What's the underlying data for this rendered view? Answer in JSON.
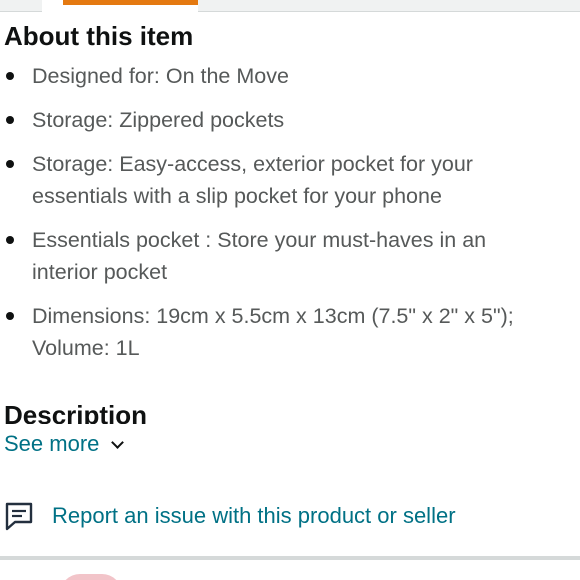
{
  "about": {
    "title": "About this item",
    "bullets": [
      {
        "text": "Designed for: On the Move"
      },
      {
        "text": "Storage: Zippered pockets"
      },
      {
        "text": "Storage: Easy-access, exterior pocket for your\nessentials with a slip pocket for your phone"
      },
      {
        "text": "Essentials pocket : Store your must-haves in an\ninterior pocket"
      },
      {
        "text": "Dimensions: 19cm x 5.5cm x 13cm (7.5\" x 2\" x 5\");\nVolume: 1L"
      }
    ]
  },
  "description": {
    "title": "Description",
    "see_more_label": "See more",
    "see_more_icon": "chevron-down-icon"
  },
  "report": {
    "label": "Report an issue with this product or seller",
    "icon": "report-message-icon"
  },
  "colors": {
    "text_primary": "#0f1111",
    "text_secondary": "#565959",
    "link": "#007185",
    "active_tab": "#e47911",
    "divider": "#d5d9d9"
  }
}
